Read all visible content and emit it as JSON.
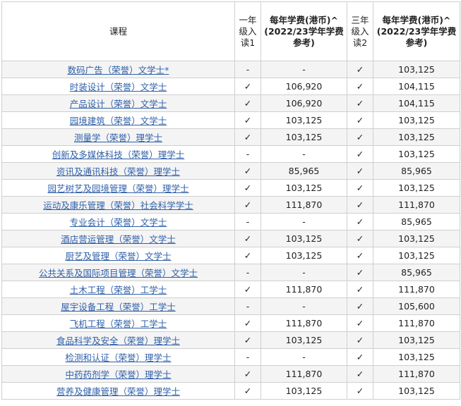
{
  "headers": {
    "course": "课程",
    "year1_entry": "一年级入读1",
    "year1_fee": "每年学费(港币)^ (2022/23学年学费参考)",
    "year3_entry": "三年级入读2",
    "year3_fee": "每年学费(港币)^ (2022/23学年学费参考)"
  },
  "rows": [
    {
      "course": "数码广告（荣誉）文学士*",
      "y1": "-",
      "f1": "-",
      "y3": "✓",
      "f3": "103,125"
    },
    {
      "course": "时装设计（荣誉）文学士",
      "y1": "✓",
      "f1": "106,920",
      "y3": "✓",
      "f3": "104,115"
    },
    {
      "course": "产品设计（荣誉）文学士",
      "y1": "✓",
      "f1": "106,920",
      "y3": "✓",
      "f3": "104,115"
    },
    {
      "course": "园境建筑（荣誉）文学士",
      "y1": "✓",
      "f1": "103,125",
      "y3": "✓",
      "f3": "103,125"
    },
    {
      "course": "测量学（荣誉）理学士",
      "y1": "✓",
      "f1": "103,125",
      "y3": "✓",
      "f3": "103,125"
    },
    {
      "course": "创新及多媒体科技（荣誉）理学士",
      "y1": "-",
      "f1": "-",
      "y3": "✓",
      "f3": "103,125"
    },
    {
      "course": "资讯及通讯科技（荣誉）理学士",
      "y1": "✓",
      "f1": "85,965",
      "y3": "✓",
      "f3": "85,965"
    },
    {
      "course": "园艺树艺及园境管理（荣誉）理学士",
      "y1": "✓",
      "f1": "103,125",
      "y3": "✓",
      "f3": "103,125"
    },
    {
      "course": "运动及康乐管理（荣誉）社会科学学士",
      "y1": "✓",
      "f1": "111,870",
      "y3": "✓",
      "f3": "111,870"
    },
    {
      "course": "专业会计（荣誉）文学士",
      "y1": "-",
      "f1": "-",
      "y3": "✓",
      "f3": "85,965"
    },
    {
      "course": "酒店营运管理（荣誉）文学士",
      "y1": "✓",
      "f1": "103,125",
      "y3": "✓",
      "f3": "103,125"
    },
    {
      "course": "厨艺及管理（荣誉）文学士",
      "y1": "✓",
      "f1": "103,125",
      "y3": "✓",
      "f3": "103,125"
    },
    {
      "course": "公共关系及国际项目管理（荣誉）文学士",
      "y1": "-",
      "f1": "-",
      "y3": "✓",
      "f3": "85,965"
    },
    {
      "course": "土木工程（荣誉）工学士",
      "y1": "✓",
      "f1": "111,870",
      "y3": "✓",
      "f3": "111,870"
    },
    {
      "course": "屋宇设备工程（荣誉）工学士",
      "y1": "-",
      "f1": "-",
      "y3": "✓",
      "f3": "105,600"
    },
    {
      "course": "飞机工程（荣誉）工学士",
      "y1": "✓",
      "f1": "111,870",
      "y3": "✓",
      "f3": "111,870"
    },
    {
      "course": "食品科学及安全（荣誉）理学士",
      "y1": "✓",
      "f1": "103,125",
      "y3": "✓",
      "f3": "103,125"
    },
    {
      "course": "检测和认证（荣誉）理学士",
      "y1": "-",
      "f1": "-",
      "y3": "✓",
      "f3": "103,125"
    },
    {
      "course": "中药药剂学（荣誉）理学士",
      "y1": "✓",
      "f1": "111,870",
      "y3": "✓",
      "f3": "111,870"
    },
    {
      "course": "营养及健康管理（荣誉）理学士",
      "y1": "✓",
      "f1": "103,125",
      "y3": "✓",
      "f3": "103,125"
    }
  ]
}
